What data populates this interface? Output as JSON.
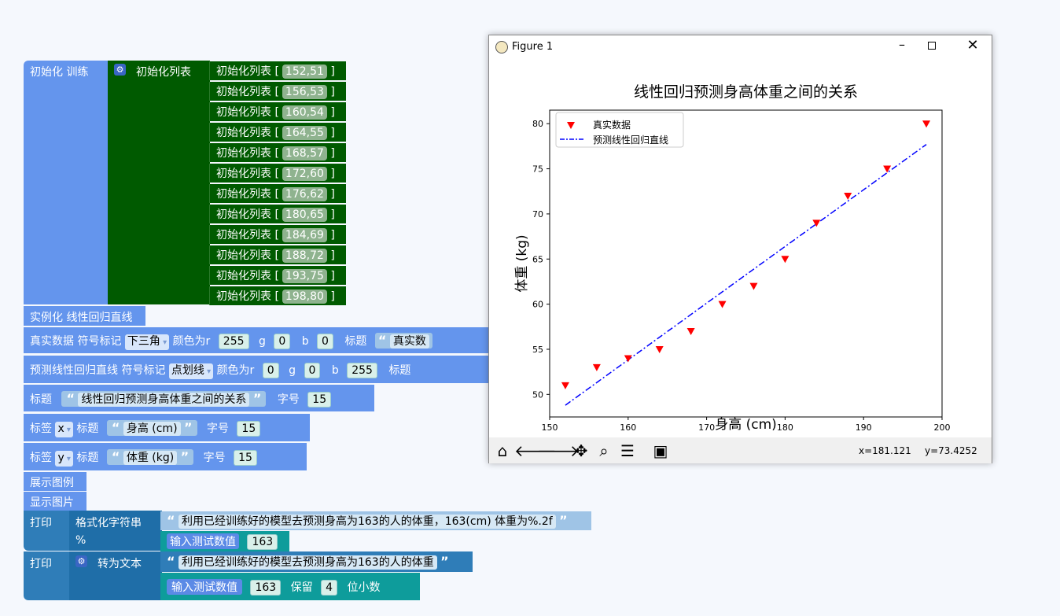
{
  "blocks": {
    "init_train": "初始化 训练",
    "init_list": "初始化列表",
    "row_prefix": "初始化列表 [",
    "row_suffix": "]",
    "rows": [
      "152,51",
      "156,53",
      "160,54",
      "164,55",
      "168,57",
      "172,60",
      "176,62",
      "180,65",
      "184,69",
      "188,72",
      "193,75",
      "198,80"
    ],
    "instantiate": "实例化 线性回归直线",
    "real": {
      "label": "真实数据 符号标记",
      "marker": "下三角",
      "color_label": "颜色为r",
      "r": "255",
      "g_label": "g",
      "g": "0",
      "b_label": "b",
      "b": "0",
      "title_label": "标题",
      "title": "真实数"
    },
    "pred": {
      "label": "预测线性回归直线 符号标记",
      "marker": "点划线",
      "color_label": "颜色为r",
      "r": "0",
      "g_label": "g",
      "g": "0",
      "b_label": "b",
      "b": "255",
      "title_label": "标题"
    },
    "title_block": {
      "label": "标题",
      "text": "线性回归预测身高体重之间的关系",
      "size_label": "字号",
      "size": "15"
    },
    "xlabel_block": {
      "label": "标签",
      "axis": "x",
      "title_label": "标题",
      "text": "身高 (cm)",
      "size_label": "字号",
      "size": "15"
    },
    "ylabel_block": {
      "label": "标签",
      "axis": "y",
      "title_label": "标题",
      "text": "体重 (kg)",
      "size_label": "字号",
      "size": "15"
    },
    "show_legend": "展示图例",
    "show_image": "显示图片",
    "print1": {
      "label": "打印",
      "fmt_label": "格式化字符串",
      "percent": "%",
      "text": "利用已经训练好的模型去预测身高为163的人的体重，163(cm) 体重为%.2f",
      "input_label": "输入测试数值",
      "input": "163"
    },
    "print2": {
      "label": "打印",
      "convert_label": "转为文本",
      "text": "利用已经训练好的模型去预测身高为163的人的体重",
      "input_label": "输入测试数值",
      "input": "163",
      "keep_label": "保留",
      "digits": "4",
      "digits_suffix": "位小数"
    }
  },
  "window": {
    "title": "Figure 1",
    "status_x": "x=181.121",
    "status_y": "y=73.4252",
    "toolbar_icons": [
      "home-icon",
      "back-icon",
      "forward-icon",
      "pan-icon",
      "zoom-icon",
      "configure-icon",
      "save-icon"
    ]
  },
  "chart_data": {
    "type": "scatter",
    "title": "线性回归预测身高体重之间的关系",
    "xlabel": "身高 (cm)",
    "ylabel": "体重 (kg)",
    "xlim": [
      150,
      200
    ],
    "ylim": [
      47.5,
      81.5
    ],
    "xticks": [
      150,
      160,
      170,
      180,
      190,
      200
    ],
    "yticks": [
      50,
      55,
      60,
      65,
      70,
      75,
      80
    ],
    "legend_placement": "upper-left",
    "series": [
      {
        "name": "真实数据",
        "kind": "scatter",
        "marker": "triangle-down",
        "color": "#ff0000",
        "x": [
          152,
          156,
          160,
          164,
          168,
          172,
          176,
          180,
          184,
          188,
          193,
          198
        ],
        "y": [
          51,
          53,
          54,
          55,
          57,
          60,
          62,
          65,
          69,
          72,
          75,
          80
        ]
      },
      {
        "name": "预测线性回归直线",
        "kind": "line",
        "style": "dash-dot",
        "color": "#0000ff",
        "x": [
          152,
          198
        ],
        "y": [
          48.8,
          77.7
        ]
      }
    ]
  }
}
